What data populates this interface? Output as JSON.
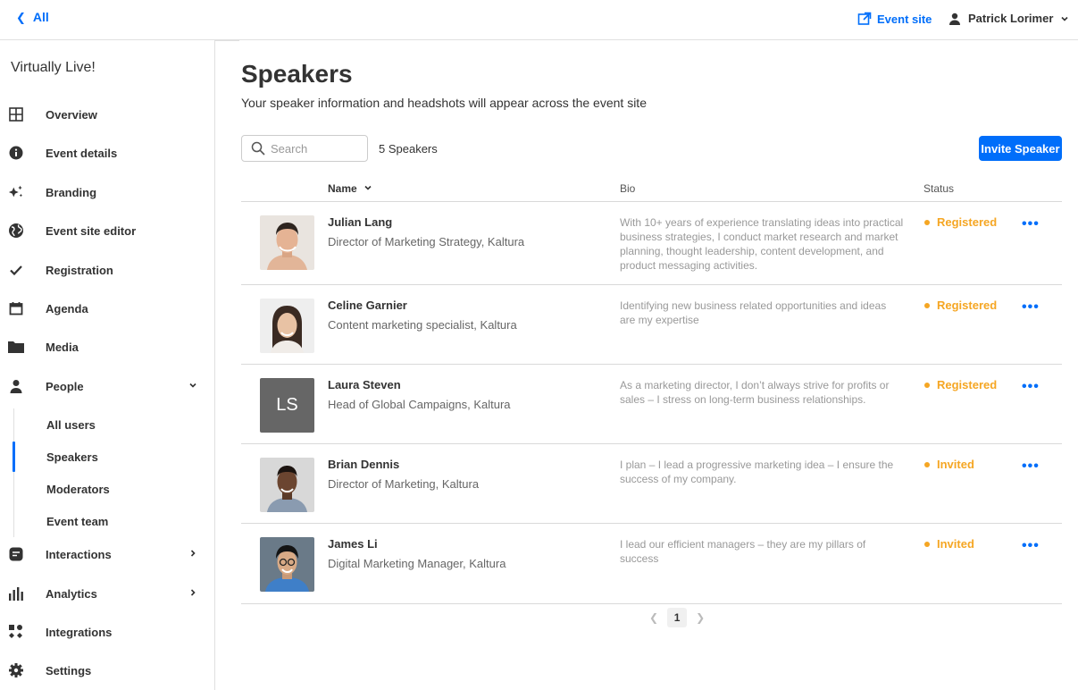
{
  "topbar": {
    "back_label": "All",
    "event_site_label": "Event site",
    "user_name": "Patrick Lorimer"
  },
  "sidebar": {
    "app_name": "Virtually Live!",
    "items": [
      {
        "label": "Overview",
        "icon": "grid-icon"
      },
      {
        "label": "Event details",
        "icon": "info-icon"
      },
      {
        "label": "Branding",
        "icon": "sparkle-icon"
      },
      {
        "label": "Event site editor",
        "icon": "globe-icon"
      },
      {
        "label": "Registration",
        "icon": "check-icon"
      },
      {
        "label": "Agenda",
        "icon": "calendar-icon"
      },
      {
        "label": "Media",
        "icon": "folder-icon"
      },
      {
        "label": "People",
        "icon": "person-icon"
      },
      {
        "label": "Interactions",
        "icon": "chat-icon"
      },
      {
        "label": "Analytics",
        "icon": "bar-chart-icon"
      },
      {
        "label": "Integrations",
        "icon": "integrations-icon"
      },
      {
        "label": "Settings",
        "icon": "gear-icon"
      }
    ],
    "people_sub": [
      "All users",
      "Speakers",
      "Moderators",
      "Event team"
    ],
    "active_sub": "Speakers"
  },
  "main": {
    "title": "Speakers",
    "subtitle": "Your speaker information and headshots will appear across the event site",
    "search_placeholder": "Search",
    "count_label": "5 Speakers",
    "invite_label": "Invite Speaker",
    "columns": {
      "name": "Name",
      "bio": "Bio",
      "status": "Status"
    },
    "speakers": [
      {
        "name": "Julian Lang",
        "title": "Director of Marketing Strategy, Kaltura",
        "bio": "With 10+ years of experience translating ideas into practical business strategies, I conduct market research and market planning, thought leadership, content development, and product messaging activities.",
        "status": "Registered",
        "avatar": "photo"
      },
      {
        "name": "Celine Garnier",
        "title": "Content marketing specialist, Kaltura",
        "bio": "Identifying new business related opportunities and ideas are my expertise",
        "status": "Registered",
        "avatar": "photo"
      },
      {
        "name": "Laura Steven",
        "title": "Head of Global Campaigns, Kaltura",
        "bio": "As a marketing director, I don’t always strive for profits or sales – I stress on long-term business relationships.",
        "status": "Registered",
        "avatar": "initials",
        "initials": "LS"
      },
      {
        "name": "Brian Dennis",
        "title": "Director of Marketing, Kaltura",
        "bio": "I plan – I lead a progressive marketing idea – I ensure the success of my company.",
        "status": "Invited",
        "avatar": "photo"
      },
      {
        "name": "James Li",
        "title": "Digital Marketing Manager, Kaltura",
        "bio": "I lead our efficient managers – they are my pillars of success",
        "status": "Invited",
        "avatar": "photo"
      }
    ],
    "pagination": {
      "current_page": "1"
    }
  },
  "colors": {
    "accent": "#006efa",
    "status": "#f5a623"
  }
}
